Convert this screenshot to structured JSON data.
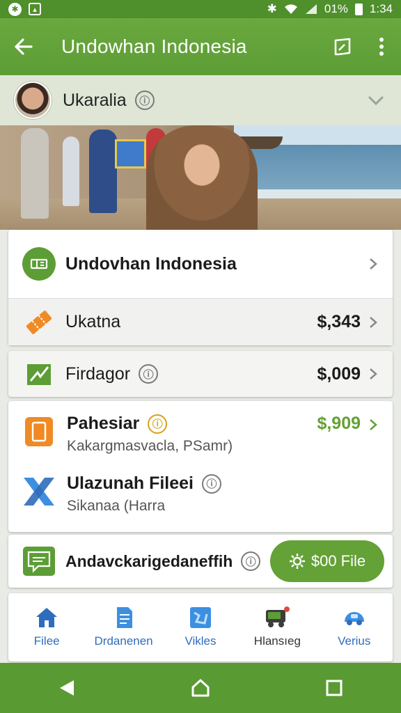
{
  "status_bar": {
    "battery": "01%",
    "time": "1:34"
  },
  "app_bar": {
    "title": "Undowhan Indonesia"
  },
  "account": {
    "name": "Ukaralia"
  },
  "list": {
    "item1": {
      "title": "Undovhan Indonesia"
    },
    "item2": {
      "title": "Ukatna",
      "amount": "$,343"
    },
    "item3": {
      "title": "Firdagor",
      "amount": "$,009"
    },
    "item4": {
      "title": "Pahesiar",
      "subtitle": "Kakargmasvacla, PSamr)",
      "amount": "$,909"
    },
    "item5": {
      "title": "Ulazunah Fileei",
      "subtitle": "Sikanaa (Harra"
    },
    "item6": {
      "title": "Andavckarigedaneffih"
    }
  },
  "cta": {
    "label": "$00 File"
  },
  "tabs": [
    {
      "label": "Filee",
      "icon": "home-icon"
    },
    {
      "label": "Drdanenen",
      "icon": "document-icon"
    },
    {
      "label": "Vikles",
      "icon": "map-icon"
    },
    {
      "label": "Hlansıeg",
      "icon": "truck-icon"
    },
    {
      "label": "Verius",
      "icon": "car-icon"
    }
  ],
  "colors": {
    "primary": "#5d9d35",
    "accent_green": "#64a136",
    "tab_blue": "#2e6dbb",
    "orange": "#f08a24"
  }
}
